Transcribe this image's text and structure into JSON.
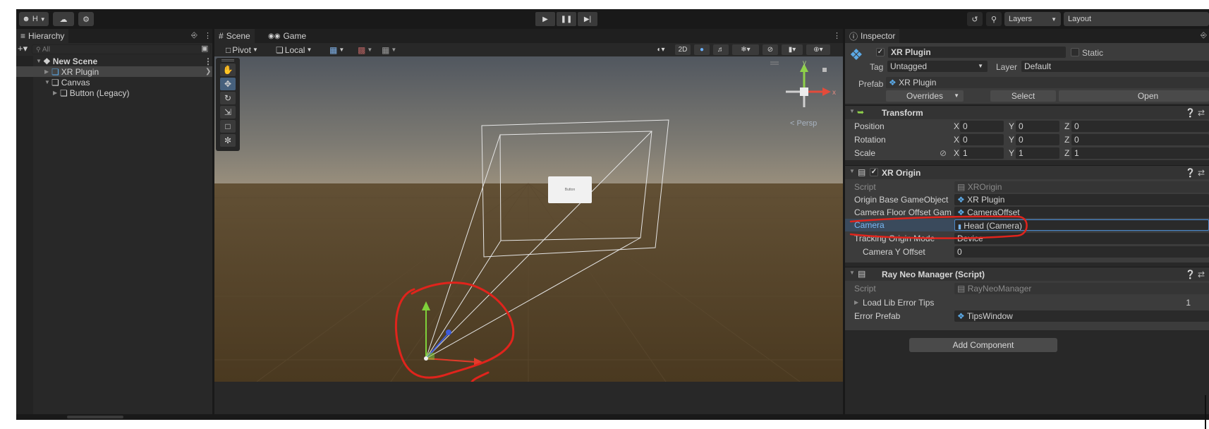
{
  "toolbar": {
    "account": "H",
    "layers_label": "Layers",
    "layout_label": "Layout"
  },
  "hierarchy": {
    "tab_label": "Hierarchy",
    "search_placeholder": "All",
    "scene_name": "New Scene",
    "items": [
      {
        "label": "XR Plugin"
      },
      {
        "label": "Canvas"
      },
      {
        "label": "Button (Legacy)"
      }
    ]
  },
  "scene": {
    "tabs": [
      {
        "label": "Scene"
      },
      {
        "label": "Game"
      }
    ],
    "pivot_label": "Pivot",
    "local_label": "Local",
    "mode_2d": "2D",
    "button_text": "Button",
    "persp_label": "< Persp",
    "gizmo_y": "y",
    "gizmo_x": "x"
  },
  "inspector": {
    "tab_label": "Inspector",
    "object_name": "XR Plugin",
    "static_label": "Static",
    "tag_label": "Tag",
    "tag_value": "Untagged",
    "layer_label": "Layer",
    "layer_value": "Default",
    "prefab_label": "Prefab",
    "prefab_value": "XR Plugin",
    "overrides_label": "Overrides",
    "select_label": "Select",
    "open_label": "Open",
    "transform": {
      "title": "Transform",
      "position_label": "Position",
      "rotation_label": "Rotation",
      "scale_label": "Scale",
      "position": {
        "x": "0",
        "y": "0",
        "z": "0"
      },
      "rotation": {
        "x": "0",
        "y": "0",
        "z": "0"
      },
      "scale": {
        "x": "1",
        "y": "1",
        "z": "1"
      },
      "axis_x": "X",
      "axis_y": "Y",
      "axis_z": "Z"
    },
    "xr_origin": {
      "title": "XR Origin",
      "script_label": "Script",
      "script_value": "XROrigin",
      "origin_base_label": "Origin Base GameObject",
      "origin_base_value": "XR Plugin",
      "camera_floor_label": "Camera Floor Offset Gam",
      "camera_floor_value": "CameraOffset",
      "camera_label": "Camera",
      "camera_value": "Head (Camera)",
      "tracking_label": "Tracking Origin Mode",
      "tracking_value": "Device",
      "camera_y_label": "Camera Y Offset",
      "camera_y_value": "0"
    },
    "ray_neo": {
      "title": "Ray Neo Manager (Script)",
      "script_label": "Script",
      "script_value": "RayNeoManager",
      "load_lib_label": "Load Lib Error Tips",
      "load_lib_value": "1",
      "error_prefab_label": "Error Prefab",
      "error_prefab_value": "TipsWindow"
    },
    "add_component_label": "Add Component"
  },
  "colors": {
    "annotation_red": "#e0241c",
    "axis_green": "#7fd13a",
    "axis_red": "#e23b2b",
    "axis_blue": "#3d5bd9",
    "selection_blue": "#4b86c4"
  }
}
